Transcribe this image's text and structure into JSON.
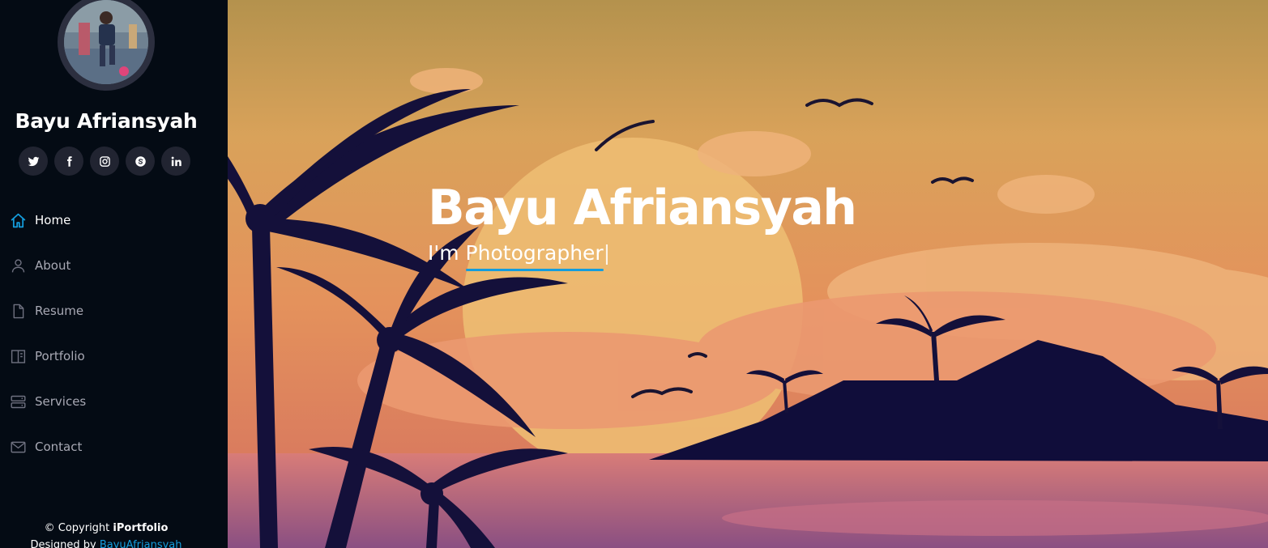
{
  "sidebar": {
    "profile_name": "Bayu Afriansyah",
    "social": [
      {
        "icon": "twitter-icon"
      },
      {
        "icon": "facebook-icon"
      },
      {
        "icon": "instagram-icon"
      },
      {
        "icon": "skype-icon"
      },
      {
        "icon": "linkedin-icon"
      }
    ],
    "nav": [
      {
        "label": "Home",
        "icon": "home-icon",
        "active": true
      },
      {
        "label": "About",
        "icon": "person-icon"
      },
      {
        "label": "Resume",
        "icon": "file-icon"
      },
      {
        "label": "Portfolio",
        "icon": "book-icon"
      },
      {
        "label": "Services",
        "icon": "server-icon"
      },
      {
        "label": "Contact",
        "icon": "envelope-icon"
      }
    ],
    "footer": {
      "copyright_prefix": "© Copyright ",
      "copyright_brand": "iPortfolio",
      "designed_prefix": "Designed by ",
      "designed_link": "BayuAfriansyah"
    }
  },
  "hero": {
    "title": "Bayu Afriansyah",
    "subtitle_prefix": "I'm ",
    "subtitle_typed": "Photographer",
    "cursor": "|"
  },
  "colors": {
    "accent": "#149ddd",
    "sidebar_bg": "#040b14",
    "social_bg": "#212431",
    "nav_text": "#a8a9b4"
  }
}
